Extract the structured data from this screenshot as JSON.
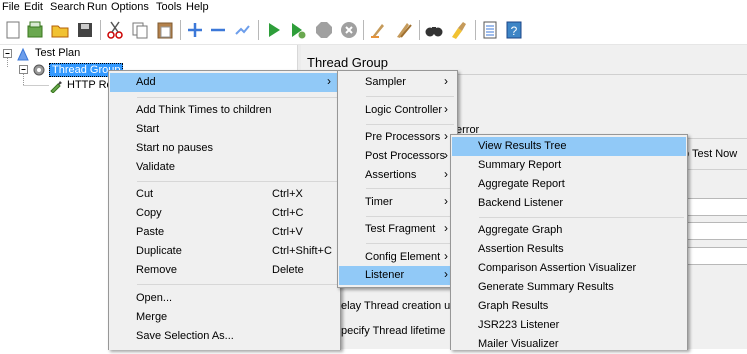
{
  "menubar": [
    "File",
    "Edit",
    "Search",
    "Run",
    "Options",
    "Tools",
    "Help"
  ],
  "tree": {
    "test_plan": "Test Plan",
    "thread_group": "Thread Group",
    "http_request": "HTTP Req"
  },
  "right_panel": {
    "title": "Thread Group",
    "error_text": "error",
    "stop_test_now": "p Test Now",
    "delay_thread": "elay Thread creation until",
    "specify_lifetime": "pecify Thread lifetime"
  },
  "context_menu": {
    "add": "Add",
    "add_think_times": "Add Think Times to children",
    "start": "Start",
    "start_no_pauses": "Start no pauses",
    "validate": "Validate",
    "cut": "Cut",
    "cut_key": "Ctrl+X",
    "copy": "Copy",
    "copy_key": "Ctrl+C",
    "paste": "Paste",
    "paste_key": "Ctrl+V",
    "duplicate": "Duplicate",
    "duplicate_key": "Ctrl+Shift+C",
    "remove": "Remove",
    "remove_key": "Delete",
    "open": "Open...",
    "merge": "Merge",
    "save_selection": "Save Selection As..."
  },
  "add_submenu": {
    "sampler": "Sampler",
    "logic_controller": "Logic Controller",
    "pre_processors": "Pre Processors",
    "post_processors": "Post Processors",
    "assertions": "Assertions",
    "timer": "Timer",
    "test_fragment": "Test Fragment",
    "config_element": "Config Element",
    "listener": "Listener"
  },
  "listener_submenu": {
    "view_results_tree": "View Results Tree",
    "summary_report": "Summary Report",
    "aggregate_report": "Aggregate Report",
    "backend_listener": "Backend Listener",
    "aggregate_graph": "Aggregate Graph",
    "assertion_results": "Assertion Results",
    "comparison_assertion_visualizer": "Comparison Assertion Visualizer",
    "generate_summary_results": "Generate Summary Results",
    "graph_results": "Graph Results",
    "jsr223_listener": "JSR223 Listener",
    "mailer_visualizer": "Mailer Visualizer"
  },
  "arrow_glyph": "›",
  "colors": {
    "highlight": "#91c9f7",
    "selection": "#3399ff"
  }
}
